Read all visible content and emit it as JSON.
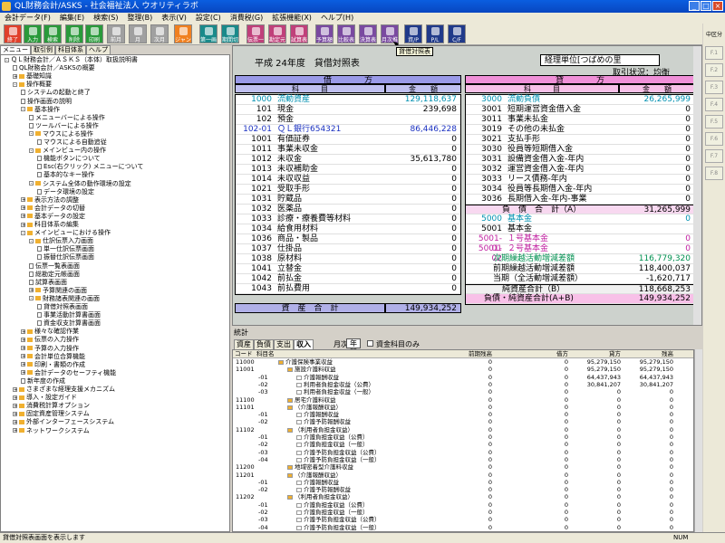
{
  "window": {
    "title": "QL財務会計/ASKS - 社会福祉法人 ウオリティラボ"
  },
  "menu": [
    "会計データ(F)",
    "編集(E)",
    "検索(S)",
    "整理(B)",
    "表示(V)",
    "設定(C)",
    "消費税(G)",
    "拡張機能(X)",
    "ヘルプ(H)"
  ],
  "toolbar": [
    {
      "label": "終了",
      "color": "red",
      "icon": "exit-icon"
    },
    {
      "label": "入力",
      "color": "green",
      "icon": "input-icon"
    },
    {
      "label": "検索",
      "color": "green",
      "icon": "search-icon"
    },
    {
      "label": "削除",
      "color": "green",
      "icon": "delete-icon"
    },
    {
      "label": "印刷",
      "color": "green",
      "icon": "print-icon"
    },
    {
      "label": "前月",
      "color": "gray",
      "icon": "arrow-left-icon"
    },
    {
      "label": "月",
      "color": "gray",
      "icon": "calendar-icon"
    },
    {
      "label": "次月",
      "color": "gray",
      "icon": "arrow-right-icon"
    },
    {
      "label": "ジャンプ",
      "color": "orange",
      "icon": "jump-icon"
    },
    {
      "label": "第一画面",
      "color": "teal",
      "icon": "home-icon"
    },
    {
      "label": "期間切替",
      "color": "teal",
      "icon": "period-icon"
    },
    {
      "label": "伝票一覧",
      "color": "pink",
      "icon": "list-icon"
    },
    {
      "label": "勘定元帳",
      "color": "pink",
      "icon": "ledger-icon"
    },
    {
      "label": "試算表",
      "color": "pink",
      "icon": "trial-icon"
    },
    {
      "label": "予算額",
      "color": "purple",
      "icon": "budget-icon"
    },
    {
      "label": "比較表",
      "color": "purple",
      "icon": "compare-icon"
    },
    {
      "label": "決算表",
      "color": "purple",
      "icon": "settle-icon"
    },
    {
      "label": "月次推移",
      "color": "purple",
      "icon": "trend-icon"
    },
    {
      "label": "資/P",
      "color": "navy",
      "icon": "bs-icon"
    },
    {
      "label": "P/L",
      "color": "navy",
      "icon": "pl-icon"
    },
    {
      "label": "C/F",
      "color": "navy",
      "icon": "cf-icon"
    }
  ],
  "tooltip": "貸借対照表",
  "left_tabs": [
    "メニュー",
    "取引例",
    "科目体系",
    "ヘルプ"
  ],
  "tree": [
    {
      "d": 0,
      "t": "ＱＬ財務会計／ＡＳＫＳ（本体）取扱説明書",
      "k": "box"
    },
    {
      "d": 1,
      "t": "QL財務会計／ASKSの概要",
      "k": "page"
    },
    {
      "d": 1,
      "t": "基礎知識",
      "k": "plus"
    },
    {
      "d": 1,
      "t": "操作概要",
      "k": "minus"
    },
    {
      "d": 2,
      "t": "システムの起動と終了",
      "k": "page"
    },
    {
      "d": 2,
      "t": "操作画面の説明",
      "k": "page"
    },
    {
      "d": 2,
      "t": "基本操作",
      "k": "minus"
    },
    {
      "d": 3,
      "t": "メニューバーによる操作",
      "k": "page"
    },
    {
      "d": 3,
      "t": "ツールバーによる操作",
      "k": "page"
    },
    {
      "d": 3,
      "t": "マウスによる操作",
      "k": "minus"
    },
    {
      "d": 4,
      "t": "マウスによる自動追従",
      "k": "page"
    },
    {
      "d": 3,
      "t": "メインビュー内の操作",
      "k": "minus"
    },
    {
      "d": 4,
      "t": "機能ボタンについて",
      "k": "page"
    },
    {
      "d": 4,
      "t": "Esc(右クリック) メニューについて",
      "k": "page"
    },
    {
      "d": 4,
      "t": "基本的なキー操作",
      "k": "page"
    },
    {
      "d": 3,
      "t": "システム全体の動作環境の設定",
      "k": "minus"
    },
    {
      "d": 4,
      "t": "データ環境の設定",
      "k": "page"
    },
    {
      "d": 2,
      "t": "表示方法の調整",
      "k": "plus"
    },
    {
      "d": 2,
      "t": "会計データの切替",
      "k": "plus"
    },
    {
      "d": 2,
      "t": "基本データの設定",
      "k": "plus"
    },
    {
      "d": 2,
      "t": "科目体系の編集",
      "k": "plus"
    },
    {
      "d": 2,
      "t": "メインビューにおける操作",
      "k": "minus"
    },
    {
      "d": 3,
      "t": "仕訳伝票入力画面",
      "k": "minus"
    },
    {
      "d": 4,
      "t": "単一仕訳伝票画面",
      "k": "page"
    },
    {
      "d": 4,
      "t": "振替仕訳伝票画面",
      "k": "page"
    },
    {
      "d": 3,
      "t": "伝票一覧表画面",
      "k": "page"
    },
    {
      "d": 3,
      "t": "総勘定元帳画面",
      "k": "page"
    },
    {
      "d": 3,
      "t": "試算表画面",
      "k": "page"
    },
    {
      "d": 3,
      "t": "予算関連の画面",
      "k": "plus"
    },
    {
      "d": 3,
      "t": "財務諸表関連の画面",
      "k": "minus"
    },
    {
      "d": 4,
      "t": "貸借対照表画面",
      "k": "page"
    },
    {
      "d": 4,
      "t": "事業活動計算書画面",
      "k": "page"
    },
    {
      "d": 4,
      "t": "資金収支計算書画面",
      "k": "page"
    },
    {
      "d": 2,
      "t": "様々な確認作業",
      "k": "plus"
    },
    {
      "d": 2,
      "t": "伝票の入力操作",
      "k": "plus"
    },
    {
      "d": 2,
      "t": "予算の入力操作",
      "k": "plus"
    },
    {
      "d": 2,
      "t": "会計単位合算機能",
      "k": "plus"
    },
    {
      "d": 2,
      "t": "印刷・書類の作成",
      "k": "plus"
    },
    {
      "d": 2,
      "t": "会計データのセーフティ機能",
      "k": "plus"
    },
    {
      "d": 2,
      "t": "新年度の作成",
      "k": "page"
    },
    {
      "d": 1,
      "t": "さまざまな経理支援メカニズム",
      "k": "plus"
    },
    {
      "d": 1,
      "t": "導入・設定ガイド",
      "k": "plus"
    },
    {
      "d": 1,
      "t": "消費税計算オプション",
      "k": "plus"
    },
    {
      "d": 1,
      "t": "固定資産管理システム",
      "k": "plus"
    },
    {
      "d": 1,
      "t": "外部インターフェースシステム",
      "k": "plus"
    },
    {
      "d": 1,
      "t": "ネットワークシステム",
      "k": "plus"
    }
  ],
  "report": {
    "title": "平成 24年度　貸借対照表",
    "unit": "経理単位[つばめの里",
    "status": "取引状況：均衡",
    "left_side": "借　　　　方",
    "right_side": "貸　　　　方",
    "col_kamoku": "科　　　目",
    "col_kingaku": "金　　額",
    "left_rows": [
      {
        "c": "1000",
        "n": "流動資産",
        "v": "129,118,637",
        "cls": "cyan"
      },
      {
        "c": "101",
        "n": "現金",
        "v": "239,698",
        "cls": ""
      },
      {
        "c": "102",
        "n": "預金",
        "v": "",
        "cls": ""
      },
      {
        "c": "102-01",
        "n": "ＱＬ銀行654321",
        "v": "86,446,228",
        "cls": "blue"
      },
      {
        "c": "1001",
        "n": "有価証券",
        "v": "0",
        "cls": ""
      },
      {
        "c": "1011",
        "n": "事業未収金",
        "v": "0",
        "cls": ""
      },
      {
        "c": "1012",
        "n": "未収金",
        "v": "35,613,780",
        "cls": ""
      },
      {
        "c": "1013",
        "n": "未収補助金",
        "v": "0",
        "cls": ""
      },
      {
        "c": "1014",
        "n": "未収収益",
        "v": "0",
        "cls": ""
      },
      {
        "c": "1021",
        "n": "受取手形",
        "v": "0",
        "cls": ""
      },
      {
        "c": "1031",
        "n": "貯蔵品",
        "v": "0",
        "cls": ""
      },
      {
        "c": "1032",
        "n": "医薬品",
        "v": "0",
        "cls": ""
      },
      {
        "c": "1033",
        "n": "診療・療養費等材料",
        "v": "0",
        "cls": ""
      },
      {
        "c": "1034",
        "n": "給食用材料",
        "v": "0",
        "cls": ""
      },
      {
        "c": "1036",
        "n": "商品・製品",
        "v": "0",
        "cls": ""
      },
      {
        "c": "1037",
        "n": "仕掛品",
        "v": "0",
        "cls": ""
      },
      {
        "c": "1038",
        "n": "原材料",
        "v": "0",
        "cls": ""
      },
      {
        "c": "1041",
        "n": "立替金",
        "v": "0",
        "cls": ""
      },
      {
        "c": "1042",
        "n": "前払金",
        "v": "0",
        "cls": ""
      },
      {
        "c": "1043",
        "n": "前払費用",
        "v": "0",
        "cls": ""
      }
    ],
    "left_total_label": "資　産　合　計",
    "left_total": "149,934,252",
    "right_rows": [
      {
        "c": "3000",
        "n": "流動負債",
        "v": "26,265,999",
        "cls": "cyan"
      },
      {
        "c": "3001",
        "n": "短期運営資金借入金",
        "v": "0",
        "cls": ""
      },
      {
        "c": "3011",
        "n": "事業未払金",
        "v": "0",
        "cls": ""
      },
      {
        "c": "3019",
        "n": "その他の未払金",
        "v": "0",
        "cls": ""
      },
      {
        "c": "3021",
        "n": "支払手形",
        "v": "0",
        "cls": ""
      },
      {
        "c": "3030",
        "n": "役員等短期借入金",
        "v": "0",
        "cls": ""
      },
      {
        "c": "3031",
        "n": "設備資金借入金-年内",
        "v": "0",
        "cls": ""
      },
      {
        "c": "3032",
        "n": "運営資金借入金-年内",
        "v": "0",
        "cls": ""
      },
      {
        "c": "3033",
        "n": "リース債務-年内",
        "v": "0",
        "cls": ""
      },
      {
        "c": "3034",
        "n": "役員等長期借入金-年内",
        "v": "0",
        "cls": ""
      },
      {
        "c": "3036",
        "n": "長期借入金-年内-事業",
        "v": "0",
        "cls": ""
      }
    ],
    "liab_total_label": "負　債　合　計（A）",
    "liab_total": "31,265,999",
    "net_rows": [
      {
        "c": "5000",
        "n": "基本金",
        "v": "0",
        "cls": "cyan"
      },
      {
        "c": "5001",
        "n": "基本金",
        "v": "",
        "cls": ""
      },
      {
        "c": "5001-01",
        "n": "１号基本金",
        "v": "0",
        "cls": "mag"
      },
      {
        "c": "5001-02",
        "n": "２号基本金",
        "v": "0",
        "cls": "mag"
      }
    ],
    "fund_rows": [
      {
        "n": "次期繰越活動増減差額",
        "v": "116,779,320",
        "cls": "green"
      },
      {
        "n": "前期繰越活動増減差額",
        "v": "118,400,037",
        "cls": ""
      },
      {
        "n": "当期（全活動増減差額）",
        "v": "-1,620,717",
        "cls": ""
      }
    ],
    "net_total_label": "純資産合計（B）",
    "net_total": "118,668,253",
    "grand_label": "負債・純資産合計(A+B)",
    "grand_total": "149,934,252"
  },
  "right_panel": [
    "中区分",
    "F.1",
    "F.2",
    "F.3",
    "F.4",
    "F.5",
    "F.6",
    "F.7",
    "F.8"
  ],
  "summary": {
    "label": "統計",
    "tabs": [
      "資産",
      "負債",
      "支出",
      "収入"
    ],
    "active_tab": "収入",
    "month_label": "月次:",
    "month_value": "年間",
    "check_label": "資金科目のみ",
    "headers": [
      "コード",
      "科目名",
      "前期残高",
      "借方",
      "貸方",
      "残高"
    ],
    "rows": [
      {
        "code": "11000",
        "name": "介護保険事業収益",
        "lv": 0,
        "a": "0",
        "b": "0",
        "c": "95,279,150",
        "d": "95,279,150"
      },
      {
        "code": "11001",
        "name": "施設介護料収益",
        "lv": 1,
        "a": "0",
        "b": "0",
        "c": "95,279,150",
        "d": "95,279,150"
      },
      {
        "code": "-01",
        "name": "介護報酬収益",
        "lv": 2,
        "a": "0",
        "b": "0",
        "c": "64,437,943",
        "d": "64,437,943"
      },
      {
        "code": "-02",
        "name": "利用者負担金収益（公費）",
        "lv": 2,
        "a": "0",
        "b": "0",
        "c": "30,841,207",
        "d": "30,841,207"
      },
      {
        "code": "-03",
        "name": "利用者負担金収益（一般）",
        "lv": 2,
        "a": "0",
        "b": "0",
        "c": "0",
        "d": "0"
      },
      {
        "code": "11100",
        "name": "居宅介護料収益",
        "lv": 1,
        "a": "0",
        "b": "0",
        "c": "0",
        "d": "0"
      },
      {
        "code": "11101",
        "name": "（介護報酬収益）",
        "lv": 1,
        "a": "0",
        "b": "0",
        "c": "0",
        "d": "0"
      },
      {
        "code": "-01",
        "name": "介護報酬収益",
        "lv": 2,
        "a": "0",
        "b": "0",
        "c": "0",
        "d": "0"
      },
      {
        "code": "-02",
        "name": "介護予防報酬収益",
        "lv": 2,
        "a": "0",
        "b": "0",
        "c": "0",
        "d": "0"
      },
      {
        "code": "11102",
        "name": "（利用者負担金収益）",
        "lv": 1,
        "a": "0",
        "b": "0",
        "c": "0",
        "d": "0"
      },
      {
        "code": "-01",
        "name": "介護負担金収益（公費）",
        "lv": 2,
        "a": "0",
        "b": "0",
        "c": "0",
        "d": "0"
      },
      {
        "code": "-02",
        "name": "介護負担金収益（一般）",
        "lv": 2,
        "a": "0",
        "b": "0",
        "c": "0",
        "d": "0"
      },
      {
        "code": "-03",
        "name": "介護予防負担金収益（公費）",
        "lv": 2,
        "a": "0",
        "b": "0",
        "c": "0",
        "d": "0"
      },
      {
        "code": "-04",
        "name": "介護予防負担金収益（一般）",
        "lv": 2,
        "a": "0",
        "b": "0",
        "c": "0",
        "d": "0"
      },
      {
        "code": "11200",
        "name": "地域密着型介護料収益",
        "lv": 1,
        "a": "0",
        "b": "0",
        "c": "0",
        "d": "0"
      },
      {
        "code": "11201",
        "name": "（介護報酬収益）",
        "lv": 1,
        "a": "0",
        "b": "0",
        "c": "0",
        "d": "0"
      },
      {
        "code": "-01",
        "name": "介護報酬収益",
        "lv": 2,
        "a": "0",
        "b": "0",
        "c": "0",
        "d": "0"
      },
      {
        "code": "-02",
        "name": "介護予防報酬収益",
        "lv": 2,
        "a": "0",
        "b": "0",
        "c": "0",
        "d": "0"
      },
      {
        "code": "11202",
        "name": "（利用者負担金収益）",
        "lv": 1,
        "a": "0",
        "b": "0",
        "c": "0",
        "d": "0"
      },
      {
        "code": "-01",
        "name": "介護負担金収益（公費）",
        "lv": 2,
        "a": "0",
        "b": "0",
        "c": "0",
        "d": "0"
      },
      {
        "code": "-02",
        "name": "介護負担金収益（一般）",
        "lv": 2,
        "a": "0",
        "b": "0",
        "c": "0",
        "d": "0"
      },
      {
        "code": "-03",
        "name": "介護予防負担金収益（公費）",
        "lv": 2,
        "a": "0",
        "b": "0",
        "c": "0",
        "d": "0"
      },
      {
        "code": "-04",
        "name": "介護予防負担金収益（一般）",
        "lv": 2,
        "a": "0",
        "b": "0",
        "c": "0",
        "d": "0"
      }
    ]
  },
  "statusbar": {
    "text": "貸借対照表画面を表示します",
    "num": "NUM"
  }
}
